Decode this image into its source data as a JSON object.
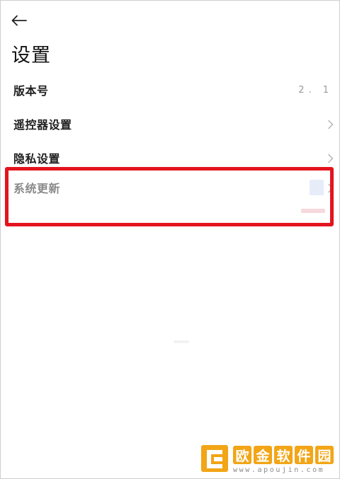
{
  "header": {
    "title": "设置"
  },
  "settings": {
    "items": [
      {
        "label": "版本号",
        "value": "2. 1"
      },
      {
        "label": "遥控器设置"
      },
      {
        "label": "隐私设置"
      },
      {
        "label": "系统更新"
      }
    ]
  },
  "watermark": {
    "brand_chars": [
      "欧",
      "金",
      "软",
      "件",
      "园"
    ],
    "url": "www.apoujin.com"
  },
  "colors": {
    "highlight": "#e3141e",
    "watermark_accent": "#f2a516"
  },
  "icons": {
    "back": "arrow-left-icon",
    "chevron": "chevron-right-icon"
  }
}
